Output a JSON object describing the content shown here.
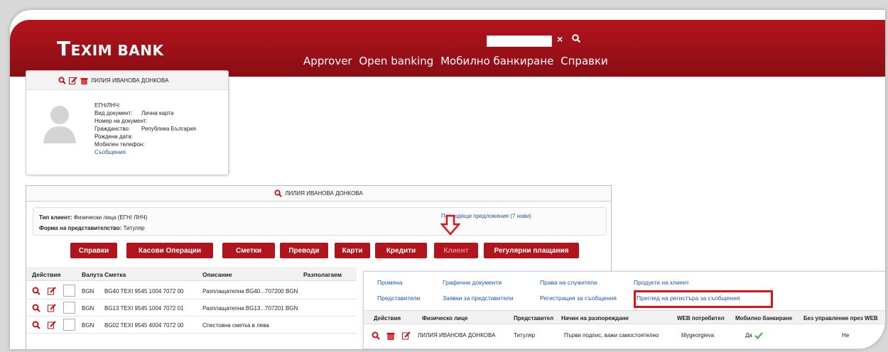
{
  "header": {
    "logo": "EXIM BANK",
    "logo_initial": "T",
    "close_glyph": "×",
    "nav": [
      "Approver",
      "Open banking",
      "Мобилно банкиране",
      "Справки"
    ]
  },
  "profile": {
    "name": "ЛИЛИЯ ИВАНОВА ДОНКОВА",
    "fields": [
      {
        "k": "ЕГН/ЛНЧ:",
        "v": ""
      },
      {
        "k": "Вид документ:",
        "v": "Лична карта"
      },
      {
        "k": "Номер на документ:",
        "v": ""
      },
      {
        "k": "Гражданство:",
        "v": "Република България"
      },
      {
        "k": "Рождена дата:",
        "v": ""
      },
      {
        "k": "Мобилен телефон:",
        "v": ""
      }
    ],
    "messages_link": "Съобщения"
  },
  "client": {
    "title": "ЛИЛИЯ ИВАНОВА ДОНКОВА",
    "type_label": "Тип клиент:",
    "type_value": "Физически лица (ЕГН/ ЛНЧ)",
    "form_label": "Форма на представителство:",
    "form_value": "Титуляр",
    "offers": "Подходящи предложения (7 нови)",
    "buttons": [
      "Справки",
      "Касови Операции",
      "Сметки",
      "Преводи",
      "Карти",
      "Кредити",
      "Клиент",
      "Регулярни плащания"
    ]
  },
  "accounts": {
    "headers": [
      "Действия",
      "Валута",
      "Сметка",
      "Описание",
      "Разполагаем"
    ],
    "rows": [
      {
        "currency": "BGN",
        "account": "BG40 TEXI 9545 1004 7072 00",
        "desc": "Разплащателна BG40...707200 BGN"
      },
      {
        "currency": "BGN",
        "account": "BG13 TEXI 9545 1004 7072 01",
        "desc": "Разплащателна BG13...707201 BGN"
      },
      {
        "currency": "BGN",
        "account": "BG02 TEXI 9545 4004 7072 00",
        "desc": "Спестовна сметка в лева"
      }
    ]
  },
  "client_menu": {
    "items": [
      "Промяна",
      "Графични документи",
      "Права на служители",
      "Продукти на клиент",
      "Представители",
      "Заявки за представители",
      "Регистрация за съобщения",
      "Преглед на регистъра за съобщения"
    ],
    "headers": [
      "Действия",
      "Физическо лице",
      "Представител",
      "Начин на разпореждане",
      "WEB потребител",
      "Мобилно банкиране",
      "Без управление през WEB"
    ],
    "row": {
      "person": "ЛИЛИЯ ИВАНОВА ДОНКОВА",
      "representative": "Титуляр",
      "disposal": "Първи подпис, важи самостоятелно",
      "web_user": "lillygeorgieva",
      "mobile": "Да",
      "no_web": "Не"
    }
  },
  "colors": {
    "brand": "#b0141c",
    "link": "#1a56a8",
    "highlight": "#e0121b"
  }
}
